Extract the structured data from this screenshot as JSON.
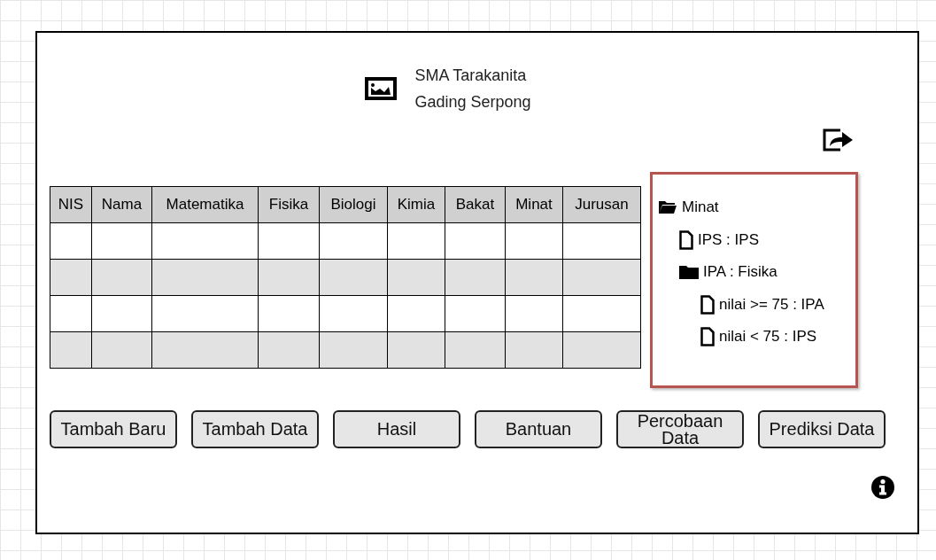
{
  "header": {
    "title_lines": [
      "SMA Tarakanita",
      "Gading Serpong"
    ]
  },
  "table": {
    "columns": [
      "NIS",
      "Nama",
      "Matematika",
      "Fisika",
      "Biologi",
      "Kimia",
      "Bakat",
      "Minat",
      "Jurusan"
    ],
    "rows": [
      {
        "shaded": false
      },
      {
        "shaded": true
      },
      {
        "shaded": false
      },
      {
        "shaded": true
      }
    ]
  },
  "tree": [
    {
      "kind": "folder",
      "label": "Minat",
      "children": [
        {
          "kind": "file",
          "label": "IPS : IPS"
        },
        {
          "kind": "folder",
          "label": "IPA : Fisika",
          "children": [
            {
              "kind": "file",
              "label": "nilai >= 75 : IPA"
            },
            {
              "kind": "file",
              "label": "nilai < 75 : IPS"
            }
          ]
        }
      ]
    }
  ],
  "buttons": [
    {
      "label": "Tambah Baru"
    },
    {
      "label": "Tambah Data"
    },
    {
      "label": "Hasil"
    },
    {
      "label": "Bantuan"
    },
    {
      "label": "Percobaan Data"
    },
    {
      "label": "Prediksi Data"
    }
  ]
}
